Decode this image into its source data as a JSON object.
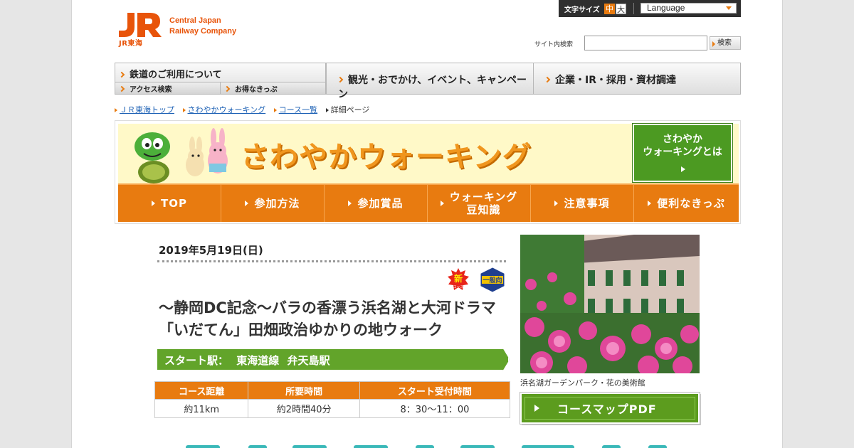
{
  "header": {
    "logo_brand_line1": "Central Japan",
    "logo_brand_line2": "Railway Company",
    "logo_sub": "JR東海",
    "font_size_label": "文字サイズ",
    "font_size_medium": "中",
    "font_size_large": "大",
    "language_select": "Language",
    "search_label": "サイト内検索",
    "search_value": "",
    "search_button": "検索"
  },
  "global_nav": {
    "rail": "鉄道のご利用について",
    "access": "アクセス検索",
    "kippu": "お得なきっぷ",
    "tourism": "観光・おでかけ、イベント、キャンペーン",
    "corporate": "企業・IR・採用・資材調達"
  },
  "breadcrumb": {
    "items": [
      "ＪＲ東海トップ",
      "さわやかウォーキング",
      "コース一覧"
    ],
    "current": "詳細ページ"
  },
  "banner": {
    "title": "さわやかウォーキング",
    "about_line1": "さわやか",
    "about_line2": "ウォーキングとは",
    "nav": {
      "top": "TOP",
      "howto": "参加方法",
      "prizes": "参加賞品",
      "trivia_line1": "ウォーキング",
      "trivia_line2": "豆知識",
      "notes": "注意事項",
      "tickets": "便利なきっぷ"
    }
  },
  "course": {
    "date": "2019年5月19日(日)",
    "badge_new": "新",
    "badge_new_sub": "コース",
    "badge_general": "一般向",
    "title": "～静岡DC記念～バラの香漂う浜名湖と大河ドラマ「いだてん」田畑政治ゆかりの地ウォーク",
    "start_label": "スタート駅：",
    "start_line": "東海道線",
    "start_station": "弁天島駅",
    "table_headers": [
      "コース距離",
      "所要時間",
      "スタート受付時間"
    ],
    "table_values": [
      "約11km",
      "約2時間40分",
      "8：30～11：00"
    ],
    "photo_caption": "浜名湖ガーデンパーク・花の美術館",
    "pdf_button": "コースマップPDF"
  },
  "colors": {
    "accent_orange": "#e87b10",
    "accent_green": "#62a42a",
    "link_blue": "#1a5fb4"
  }
}
